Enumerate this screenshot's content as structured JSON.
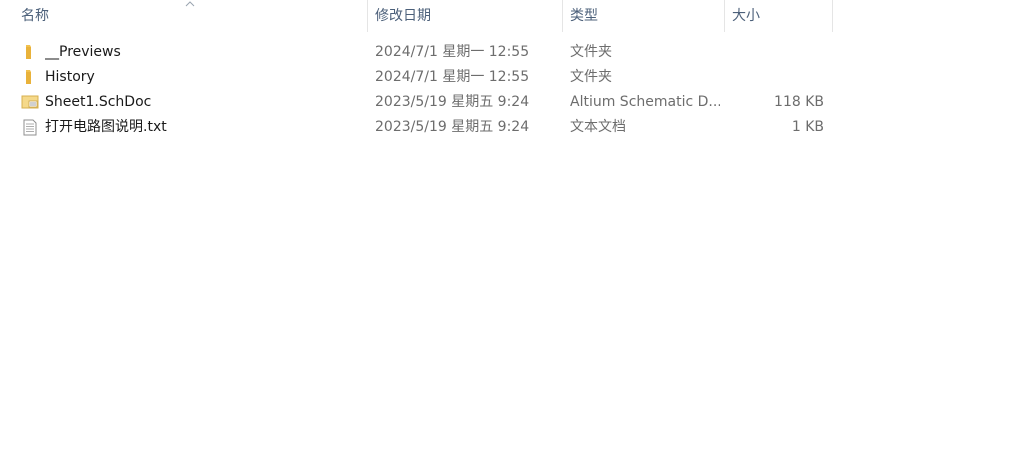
{
  "columns": {
    "name": "名称",
    "date": "修改日期",
    "type": "类型",
    "size": "大小"
  },
  "sort_icon": "chevron-up-icon",
  "files": [
    {
      "name": "__Previews",
      "date": "2024/7/1 星期一 12:55",
      "type": "文件夹",
      "size": "",
      "icon": "folder-icon"
    },
    {
      "name": "History",
      "date": "2024/7/1 星期一 12:55",
      "type": "文件夹",
      "size": "",
      "icon": "folder-icon"
    },
    {
      "name": "Sheet1.SchDoc",
      "date": "2023/5/19 星期五 9:24",
      "type": "Altium Schematic D...",
      "size": "118 KB",
      "icon": "schematic-file-icon"
    },
    {
      "name": "打开电路图说明.txt",
      "date": "2023/5/19 星期五 9:24",
      "type": "文本文档",
      "size": "1 KB",
      "icon": "text-file-icon"
    }
  ],
  "colors": {
    "header_text": "#4c607a",
    "folder": "#f2c14e",
    "meta_text": "#6d6d6d"
  }
}
